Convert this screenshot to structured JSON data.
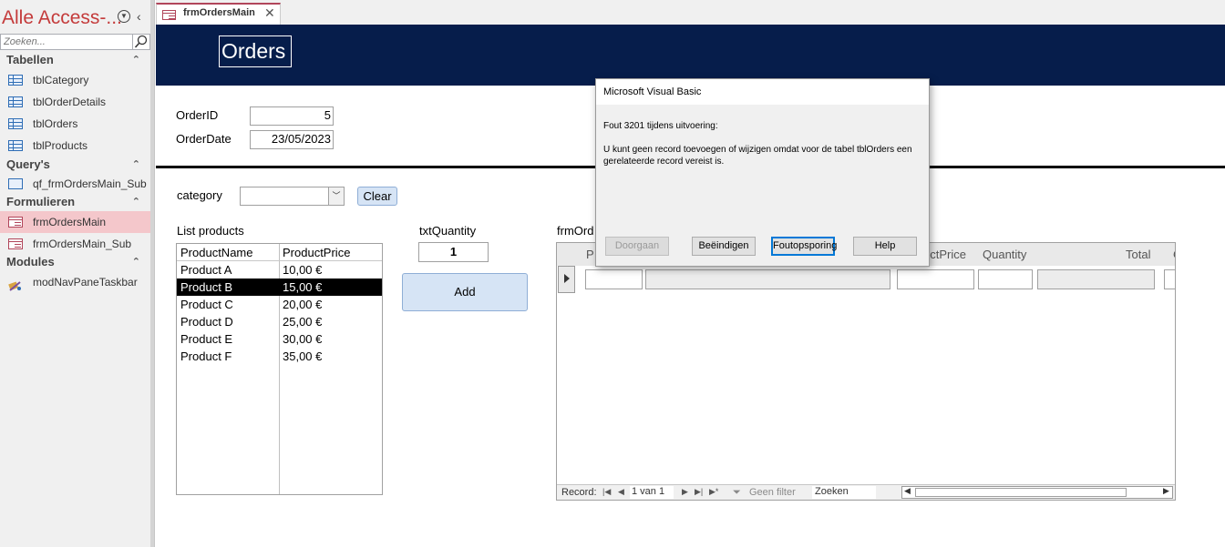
{
  "nav": {
    "title": "Alle Access-...",
    "search_placeholder": "Zoeken...",
    "groups": [
      {
        "label": "Tabellen",
        "items": [
          "tblCategory",
          "tblOrderDetails",
          "tblOrders",
          "tblProducts"
        ]
      },
      {
        "label": "Query's",
        "items": [
          "qf_frmOrdersMain_Sub"
        ]
      },
      {
        "label": "Formulieren",
        "items": [
          "frmOrdersMain",
          "frmOrdersMain_Sub"
        ],
        "selected": "frmOrdersMain"
      },
      {
        "label": "Modules",
        "items": [
          "modNavPaneTaskbar"
        ]
      }
    ]
  },
  "tab": {
    "label": "frmOrdersMain"
  },
  "form": {
    "title": "Orders",
    "order_id_label": "OrderID",
    "order_id_value": "5",
    "order_date_label": "OrderDate",
    "order_date_value": "23/05/2023",
    "category_label": "category",
    "category_value": "",
    "clear_label": "Clear",
    "list_label": "List products",
    "list_headers": [
      "ProductName",
      "ProductPrice"
    ],
    "list_rows": [
      [
        "Product A",
        "10,00 €"
      ],
      [
        "Product B",
        "15,00 €"
      ],
      [
        "Product C",
        "20,00 €"
      ],
      [
        "Product D",
        "25,00 €"
      ],
      [
        "Product E",
        "30,00 €"
      ],
      [
        "Product F",
        "35,00 €"
      ]
    ],
    "list_selected": "Product B",
    "qty_label": "txtQuantity",
    "qty_value": "1",
    "add_label": "Add"
  },
  "subform": {
    "label": "frmOrd",
    "headers": {
      "first": "P",
      "price": "uctPrice",
      "quantity": "Quantity",
      "total": "Total",
      "last": "C"
    },
    "nav": {
      "record_label": "Record:",
      "record_value": "1 van 1",
      "filter_label": "Geen filter",
      "search_label": "Zoeken"
    }
  },
  "dialog": {
    "title": "Microsoft Visual Basic",
    "line1": "Fout 3201 tijdens uitvoering:",
    "message": "U kunt geen record toevoegen of wijzigen omdat voor de tabel tblOrders een gerelateerde record vereist is.",
    "buttons": {
      "continue": "Doorgaan",
      "end": "Beëindigen",
      "debug": "Foutopsporing",
      "help": "Help"
    }
  }
}
